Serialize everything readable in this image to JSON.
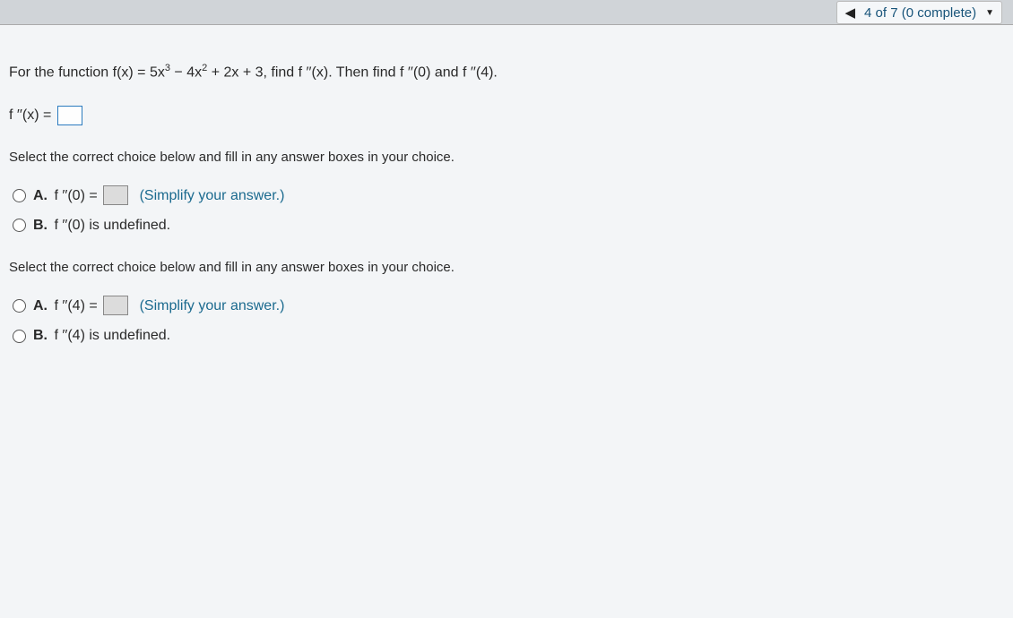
{
  "header": {
    "truncated_text": "",
    "nav": {
      "progress_text": "4 of 7 (0 complete)"
    }
  },
  "problem": {
    "statement_prefix": "For the function f(x) = 5x",
    "exp1": "3",
    "mid1": " − 4x",
    "exp2": "2",
    "mid2": " + 2x + 3, find f ′′(x). Then find f ′′(0) and f ′′(4).",
    "answer_label": "f ′′(x) = "
  },
  "section1": {
    "instruction": "Select the correct choice below and fill in any answer boxes in your choice.",
    "choices": {
      "a_label": "A.",
      "a_text": "f ′′(0) = ",
      "a_suffix": "(Simplify your answer.)",
      "b_label": "B.",
      "b_text": "f ′′(0) is undefined."
    }
  },
  "section2": {
    "instruction": "Select the correct choice below and fill in any answer boxes in your choice.",
    "choices": {
      "a_label": "A.",
      "a_text": "f ′′(4) = ",
      "a_suffix": "(Simplify your answer.)",
      "b_label": "B.",
      "b_text": "f ′′(4) is undefined."
    }
  }
}
